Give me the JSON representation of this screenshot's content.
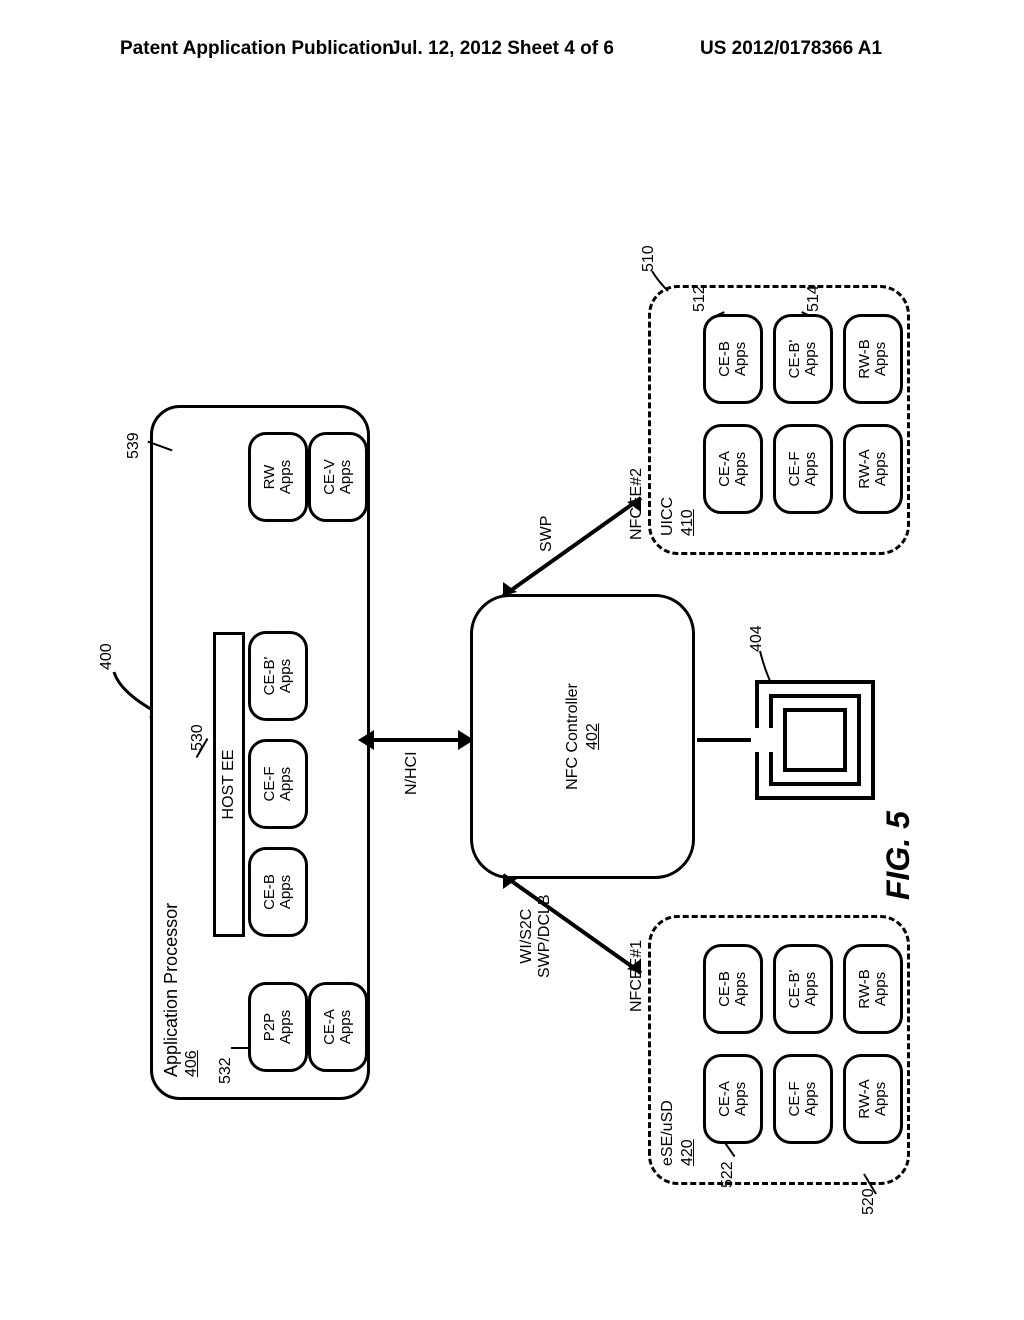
{
  "header": {
    "left": "Patent Application Publication",
    "mid": "Jul. 12, 2012  Sheet 4 of 6",
    "right": "US 2012/0178366 A1"
  },
  "figure_label": "FIG. 5",
  "ref": {
    "r400": "400",
    "r402": "402",
    "r404": "404",
    "r406": "406",
    "r410": "410",
    "r420": "420",
    "r510": "510",
    "r512": "512",
    "r514": "514",
    "r520": "520",
    "r522": "522",
    "r530": "530",
    "r532": "532",
    "r539": "539"
  },
  "ap": {
    "title": "Application Processor",
    "host_ee": "HOST EE",
    "p2p": "P2P\nApps",
    "cea": "CE-A\nApps",
    "ceb": "CE-B\nApps",
    "cef": "CE-F\nApps",
    "cebp": "CE-B'\nApps",
    "rw": "RW\nApps",
    "cev": "CE-V\nApps"
  },
  "nfccee1": {
    "title": "NFCEE#1",
    "chip": "eSE/uSD",
    "cea": "CE-A\nApps",
    "ceb": "CE-B\nApps",
    "cef": "CE-F\nApps",
    "cebp": "CE-B'\nApps",
    "rwa": "RW-A\nApps",
    "rwb": "RW-B\nApps"
  },
  "nfccee2": {
    "title": "NFCEE#2",
    "chip": "UICC",
    "cea": "CE-A\nApps",
    "ceb": "CE-B\nApps",
    "cef": "CE-F\nApps",
    "cebp": "CE-B'\nApps",
    "rwa": "RW-A\nApps",
    "rwb": "RW-B\nApps"
  },
  "nfc": {
    "title": "NFC Controller"
  },
  "links": {
    "nhci": "N/HCI",
    "left": "WI/S2C\nSWP/DCLB",
    "right": "SWP"
  }
}
